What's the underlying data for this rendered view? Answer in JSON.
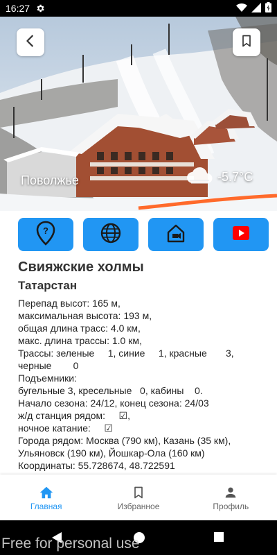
{
  "status_bar": {
    "time": "16:27"
  },
  "hero": {
    "region": "Поволжье",
    "temperature": "-5.7°C",
    "weather_icon": "cloud-icon"
  },
  "actions": [
    {
      "icon": "location-help-icon",
      "color": "#2196f3"
    },
    {
      "icon": "globe-icon",
      "color": "#2196f3"
    },
    {
      "icon": "home-camera-icon",
      "color": "#2196f3"
    },
    {
      "icon": "youtube-icon",
      "color": "#2196f3"
    }
  ],
  "resort": {
    "name": "Свияжские холмы",
    "region": "Татарстан",
    "lines": [
      "Перепад высот: 165 м,",
      "максимальная высота: 193 м,",
      "общая длина трасс: 4.0 км,",
      "макс. длина трассы:  1.0 км,",
      "Трассы: зеленые     1, синие     1, красные       3,",
      "черные        0",
      "Подъемники:",
      "бугельные 3, кресельные   0, кабины    0.",
      "Начало сезона: 24/12, конец сезона: 24/03",
      "ж/д станция рядом:     ☑,",
      "ночное катание:     ☑",
      "Города рядом: Москва (790 км), Казань (35 км),",
      "Ульяновск (190 км), Йошкар-Ола (160 км)",
      "Координаты: 55.728674, 48.722591"
    ]
  },
  "bottom_nav": [
    {
      "label": "Главная",
      "icon": "home-icon",
      "active": true
    },
    {
      "label": "Избранное",
      "icon": "bookmark-icon",
      "active": false
    },
    {
      "label": "Профиль",
      "icon": "person-icon",
      "active": false
    }
  ],
  "watermark": "Free for personal use",
  "colors": {
    "accent": "#2196f3",
    "youtube": "#ff0000"
  }
}
